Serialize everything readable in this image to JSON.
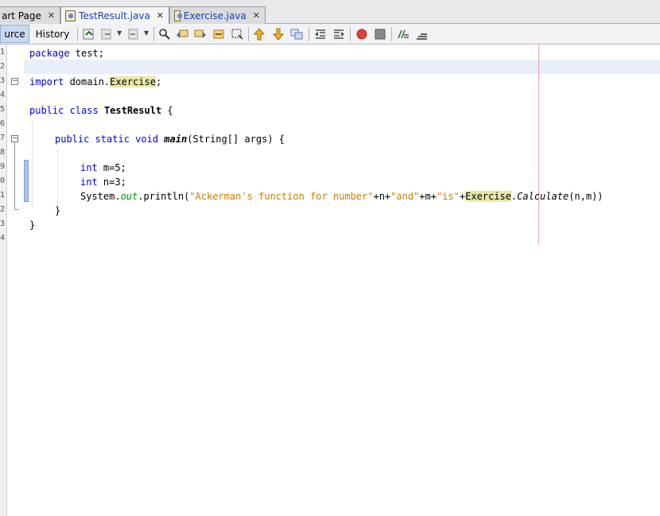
{
  "tabs": [
    {
      "label": "art Page",
      "close": "✕",
      "active": false
    },
    {
      "label": "TestResult.java",
      "close": "✕",
      "active": true
    },
    {
      "label": "Exercise.java",
      "close": "✕",
      "active": false
    }
  ],
  "toolbar": {
    "source_label": "urce",
    "history_label": "History"
  },
  "gutter": {
    "line_numbers": [
      "1",
      "2",
      "3",
      "4",
      "5",
      "6",
      "7",
      "8",
      "9",
      "0",
      "1",
      "2",
      "3",
      "4"
    ]
  },
  "code": {
    "l1_kw": "package",
    "l1_rest": " test;",
    "l3_kw": "import",
    "l3_pkg": " domain.",
    "l3_cls": "Exercise",
    "l3_end": ";",
    "l5_kw": "public class",
    "l5_sp": " ",
    "l5_name": "TestResult",
    "l5_end": " {",
    "l7_kw": "public static void",
    "l7_sp": " ",
    "l7_name": "main",
    "l7_rest": "(String[] args) {",
    "l9_kw": "int",
    "l9_rest": " m=5;",
    "l10_kw": "int",
    "l10_rest": " n=3;",
    "l11_a": "System.",
    "l11_field": "out",
    "l11_b": ".println(",
    "l11_s1": "\"Ackerman's function for number\"",
    "l11_c": "+n+",
    "l11_s2": "\"and\"",
    "l11_d": "+m+",
    "l11_s3": "\"is\"",
    "l11_e": "+",
    "l11_cls": "Exercise",
    "l11_f": ".",
    "l11_method": "Calculate",
    "l11_g": "(n,m))",
    "l12": "}",
    "l13": "}"
  }
}
